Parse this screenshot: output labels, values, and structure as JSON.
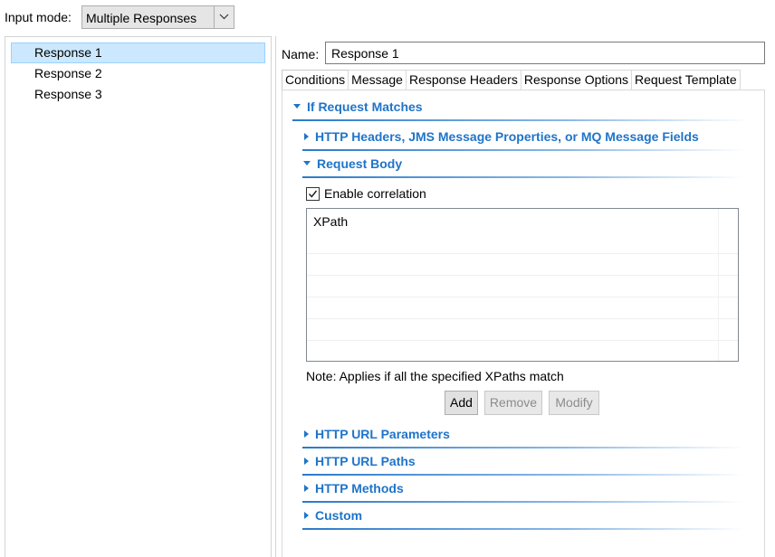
{
  "input_mode": {
    "label": "Input mode:",
    "selected": "Multiple Responses"
  },
  "responses": [
    {
      "label": "Response 1",
      "selected": true
    },
    {
      "label": "Response 2",
      "selected": false
    },
    {
      "label": "Response 3",
      "selected": false
    }
  ],
  "name": {
    "label": "Name:",
    "value": "Response 1"
  },
  "tabs": [
    {
      "label": "Conditions",
      "active": true
    },
    {
      "label": "Message",
      "active": false
    },
    {
      "label": "Response Headers",
      "active": false
    },
    {
      "label": "Response Options",
      "active": false
    },
    {
      "label": "Request Template",
      "active": false
    }
  ],
  "conditions": {
    "if_request_matches": "If Request Matches",
    "http_headers": "HTTP Headers, JMS Message Properties, or MQ Message Fields",
    "request_body": "Request Body",
    "enable_correlation": {
      "label": "Enable correlation",
      "checked": true
    },
    "xpath_column": "XPath",
    "note": "Note: Applies if all the specified XPaths match",
    "buttons": {
      "add": "Add",
      "remove": "Remove",
      "modify": "Modify"
    },
    "http_url_parameters": "HTTP URL Parameters",
    "http_url_paths": "HTTP URL Paths",
    "http_methods": "HTTP Methods",
    "custom": "Custom"
  },
  "colors": {
    "section_heading": "#1f74c9",
    "selection_bg": "#cce8ff",
    "selection_border": "#99d1ff"
  }
}
